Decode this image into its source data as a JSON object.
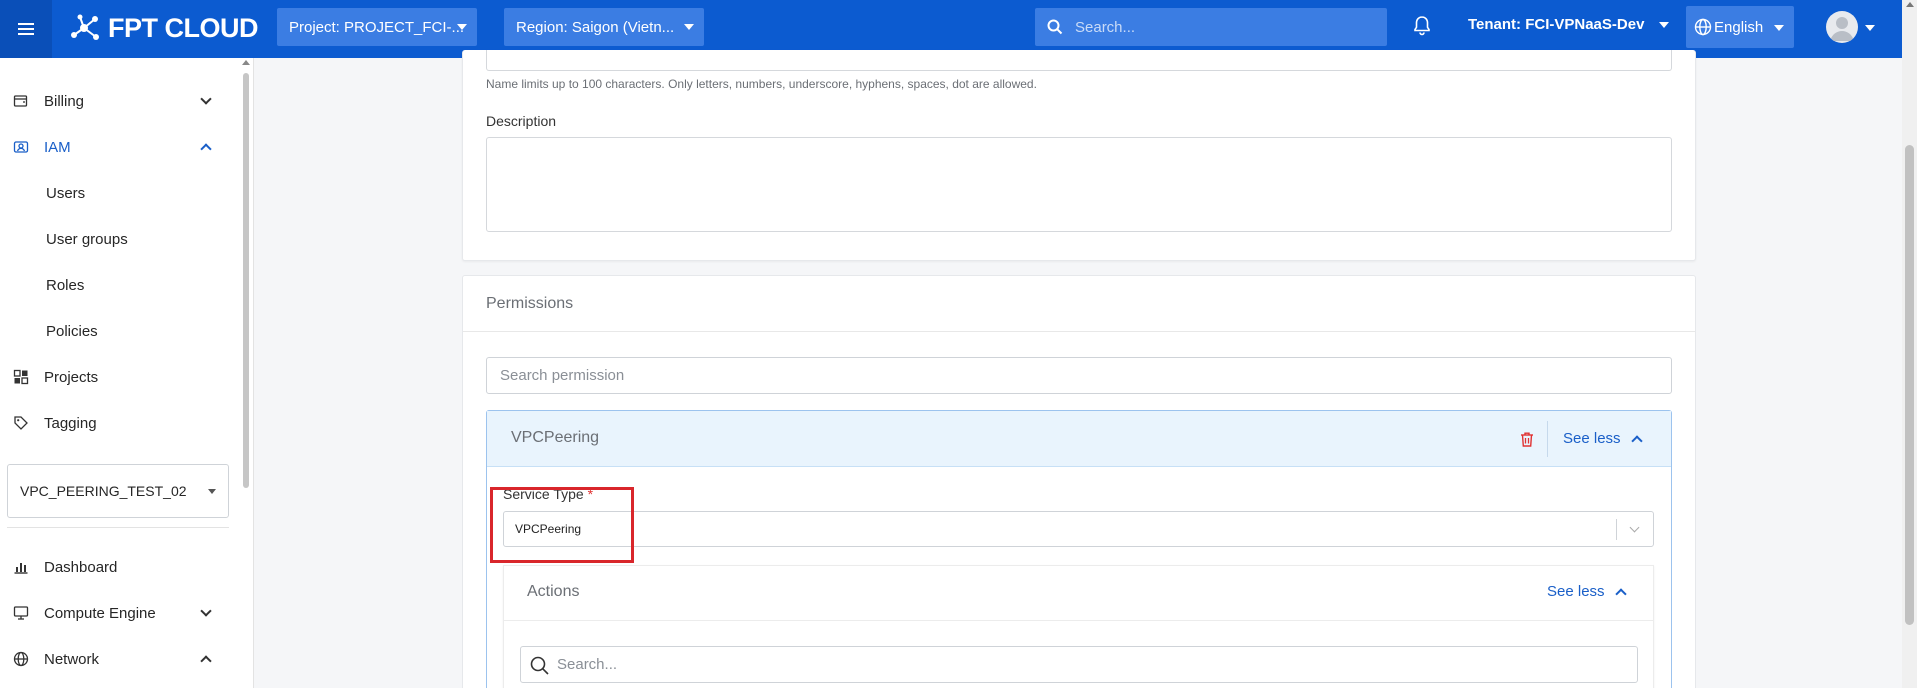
{
  "topbar": {
    "brand": "FPT CLOUD",
    "project": "Project: PROJECT_FCI-...",
    "region": "Region: Saigon (Vietn...",
    "search_placeholder": "Search...",
    "tenant": "Tenant: FCI-VPNaaS-Dev",
    "language": "English"
  },
  "sidebar": {
    "items": [
      {
        "label": "Billing",
        "icon": "billing-icon",
        "state": "collapsed"
      },
      {
        "label": "IAM",
        "icon": "iam-icon",
        "state": "expanded",
        "active": true
      },
      {
        "label": "Users"
      },
      {
        "label": "User groups"
      },
      {
        "label": "Roles"
      },
      {
        "label": "Policies"
      },
      {
        "label": "Projects",
        "icon": "projects-icon"
      },
      {
        "label": "Tagging",
        "icon": "tag-icon"
      }
    ],
    "project_selector": "VPC_PEERING_TEST_02",
    "bottom_items": [
      {
        "label": "Dashboard",
        "icon": "chart-icon"
      },
      {
        "label": "Compute Engine",
        "icon": "monitor-icon",
        "state": "collapsed"
      },
      {
        "label": "Network",
        "icon": "globe-icon",
        "state": "expanded"
      }
    ]
  },
  "form": {
    "name_hint": "Name limits up to 100 characters. Only letters, numbers, underscore, hyphens, spaces, dot are allowed.",
    "description_label": "Description",
    "description_value": ""
  },
  "permissions": {
    "title": "Permissions",
    "search_placeholder": "Search permission",
    "service": {
      "name": "VPCPeering",
      "see_less": "See less",
      "service_type_label": "Service Type",
      "required_mark": "*",
      "service_type_value": "VPCPeering",
      "actions": {
        "title": "Actions",
        "see_less": "See less",
        "search_placeholder": "Search..."
      }
    }
  },
  "colors": {
    "brand": "#0c5bd0",
    "accent": "#1a5fc8",
    "highlight": "#d9262b",
    "danger": "#e03131"
  }
}
